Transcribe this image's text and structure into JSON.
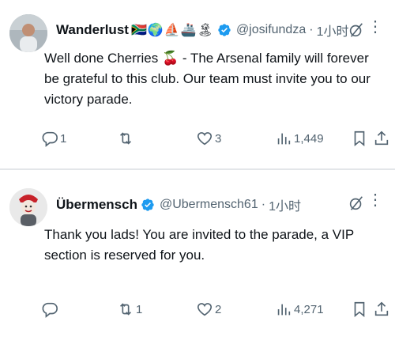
{
  "tweets": [
    {
      "name": "Wanderlust",
      "emojis": "🇿🇦🌍⛵🚢🏝",
      "handle": "@josifundza",
      "dot": "·",
      "time": "1小时",
      "text": "Well done Cherries 🍒 - The Arsenal family will forever be grateful to this club. Our team must invite you to our victory parade.",
      "replies": "1",
      "retweets": "",
      "likes": "3",
      "views": "1,449",
      "more": "⋮"
    },
    {
      "name": "Übermensch",
      "emojis": "",
      "handle": "@Ubermensch61",
      "dot": "·",
      "time": "1小时",
      "text": "Thank you lads! You are invited to the parade, a VIP section is reserved for you.",
      "replies": "",
      "retweets": "1",
      "likes": "2",
      "views": "4,271",
      "more": "⋮"
    }
  ],
  "colors": {
    "text": "#0f1419",
    "secondary": "#536471",
    "verified": "#1d9bf0",
    "divider": "#e3e6e9"
  },
  "icons": {
    "reply": "reply-icon",
    "retweet": "retweet-icon",
    "like": "heart-icon",
    "views": "views-icon",
    "bookmark": "bookmark-icon",
    "share": "share-icon",
    "grok": "grok-icon",
    "verified": "verified-badge-icon"
  }
}
